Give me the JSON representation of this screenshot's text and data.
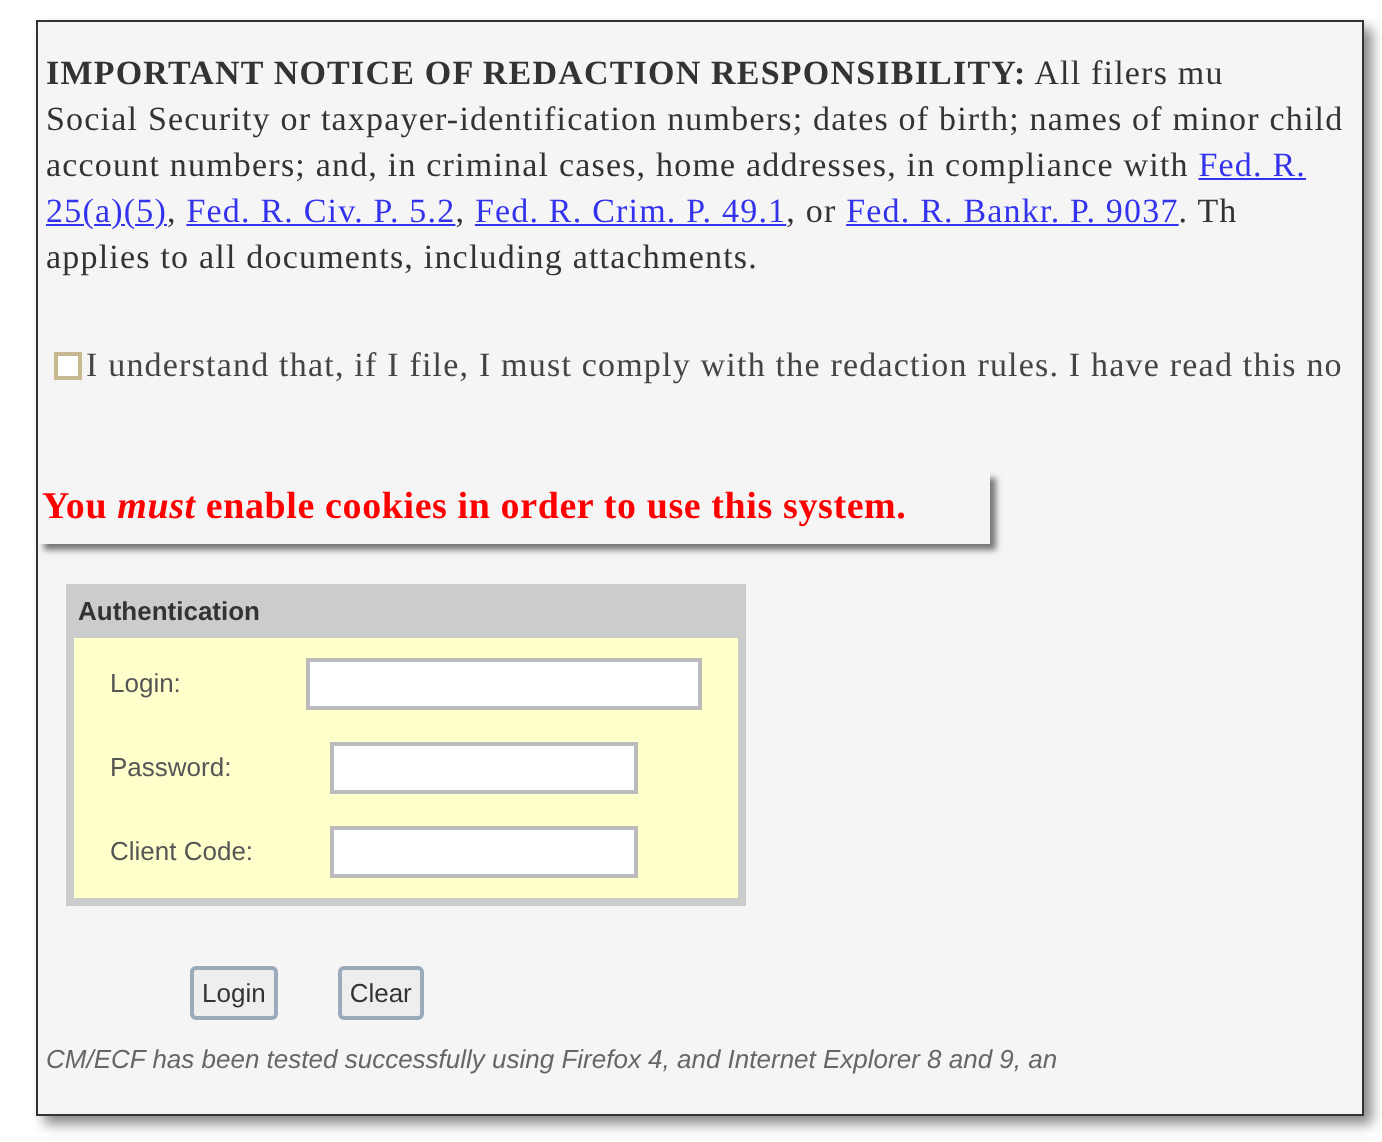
{
  "notice": {
    "lines": [
      [
        {
          "kind": "bold",
          "text": "IMPORTANT NOTICE OF REDACTION RESPONSIBILITY:"
        },
        {
          "kind": "text",
          "text": " All filers mu"
        }
      ],
      [
        {
          "kind": "text",
          "text": "Social Security or taxpayer-identification numbers; dates of birth; names of minor child"
        }
      ],
      [
        {
          "kind": "text",
          "text": "account numbers; and, in criminal cases, home addresses, in compliance with "
        },
        {
          "kind": "link",
          "text": "Fed. R."
        }
      ],
      [
        {
          "kind": "link",
          "text": "25(a)(5)"
        },
        {
          "kind": "text",
          "text": ", "
        },
        {
          "kind": "link",
          "text": "Fed. R. Civ. P. 5.2"
        },
        {
          "kind": "text",
          "text": ", "
        },
        {
          "kind": "link",
          "text": "Fed. R. Crim. P. 49.1"
        },
        {
          "kind": "text",
          "text": ", or "
        },
        {
          "kind": "link",
          "text": "Fed. R. Bankr. P. 9037"
        },
        {
          "kind": "text",
          "text": ". Th"
        }
      ],
      [
        {
          "kind": "text",
          "text": "applies to all documents, including attachments."
        }
      ]
    ]
  },
  "agreement": {
    "label": "I understand that, if I file, I must comply with the redaction rules. I have read this no",
    "checked": false
  },
  "cookie_warning": "You *must* enable cookies in order to use this system.",
  "authentication": {
    "title": "Authentication",
    "fields": [
      {
        "label": "Login:",
        "wide": true
      },
      {
        "label": "Password:",
        "wide": false
      },
      {
        "label": "Client Code:",
        "wide": false
      }
    ]
  },
  "buttons": [
    "Login",
    "Clear"
  ],
  "footer": "CM/ECF has been tested successfully using Firefox 4, and Internet Explorer 8 and 9, an"
}
